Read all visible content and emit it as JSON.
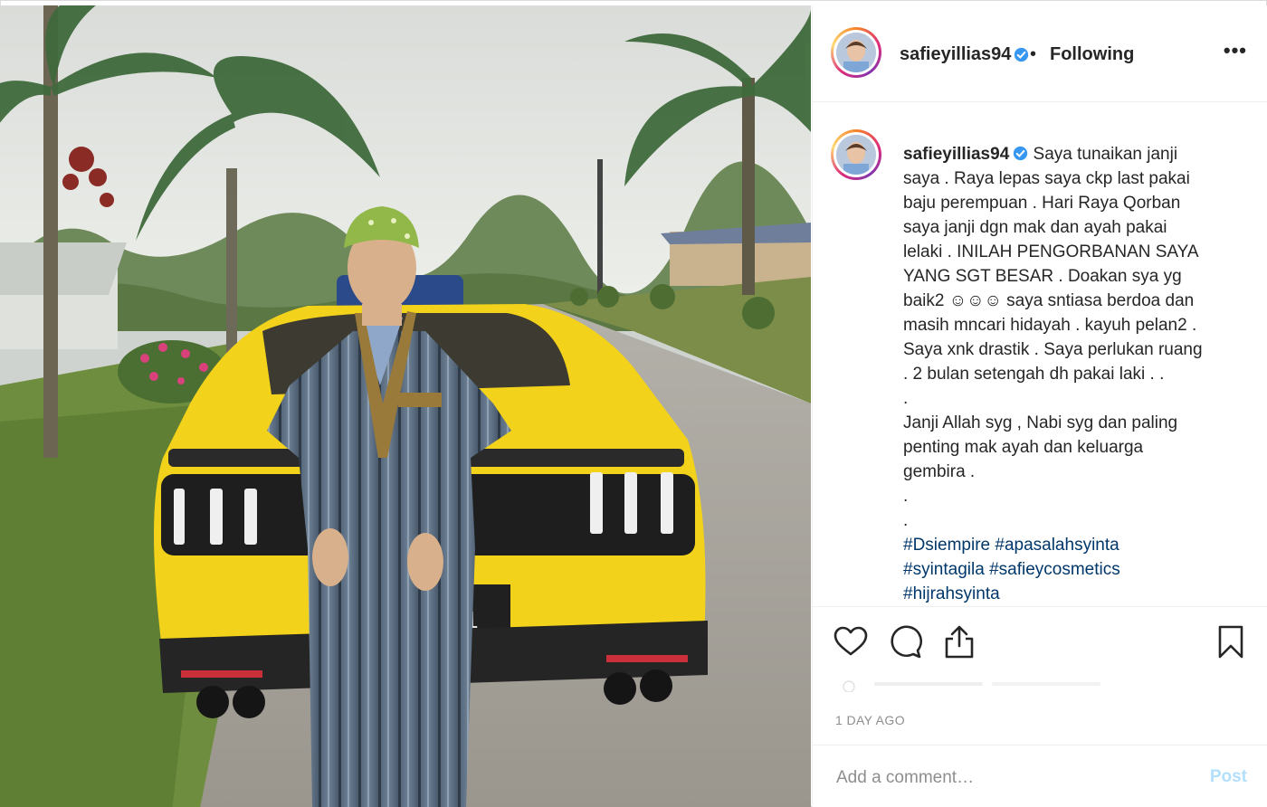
{
  "post": {
    "username": "safieyillias94",
    "separator": "•",
    "follow_status": "Following",
    "more_glyph": "•••",
    "caption_lines": [
      "Saya tunaikan janji",
      "saya . Raya lepas saya ckp last pakai",
      "baju perempuan . Hari Raya Qorban",
      "saya janji dgn mak dan ayah pakai",
      "lelaki . INILAH PENGORBANAN SAYA",
      "YANG SGT BESAR . Doakan sya yg",
      "baik2 ☺☺☺ saya sntiasa berdoa dan",
      "masih mncari hidayah . kayuh pelan2 .",
      "Saya xnk drastik . Saya perlukan ruang",
      ". 2 bulan setengah dh pakai laki . .",
      ".",
      "Janji Allah syg , Nabi syg dan paling",
      "penting mak ayah dan keluarga",
      "gembira .",
      ".",
      "."
    ],
    "hashtags": [
      [
        "#Dsiempire",
        "#apasalahsyinta"
      ],
      [
        "#syintagila",
        "#safieycosmetics"
      ],
      [
        "#hijrahsyinta"
      ]
    ],
    "timestamp": "1 DAY AGO",
    "comment_placeholder": "Add a comment…",
    "post_label": "Post"
  },
  "icons": {
    "like": "heart-icon",
    "comment": "comment-bubble-icon",
    "share": "share-icon",
    "save": "bookmark-icon",
    "verified": "verified-badge-icon"
  },
  "colors": {
    "link": "#00376b",
    "verified": "#3897f0",
    "post_disabled": "#b2dffc",
    "muted": "#8e8e8e",
    "car": "#f2d21a"
  }
}
